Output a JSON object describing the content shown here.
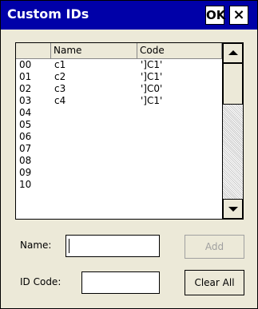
{
  "window": {
    "title": "Custom IDs",
    "ok_label": "OK",
    "close_label": "×"
  },
  "list": {
    "columns": [
      "",
      "Name",
      "Code"
    ],
    "rows": [
      {
        "idx": "00",
        "name": "c1",
        "code": "']C1'"
      },
      {
        "idx": "01",
        "name": "c2",
        "code": "']C1'"
      },
      {
        "idx": "02",
        "name": "c3",
        "code": "']C0'"
      },
      {
        "idx": "03",
        "name": "c4",
        "code": "']C1'"
      },
      {
        "idx": "04",
        "name": "",
        "code": ""
      },
      {
        "idx": "05",
        "name": "",
        "code": ""
      },
      {
        "idx": "06",
        "name": "",
        "code": ""
      },
      {
        "idx": "07",
        "name": "",
        "code": ""
      },
      {
        "idx": "08",
        "name": "",
        "code": ""
      },
      {
        "idx": "09",
        "name": "",
        "code": ""
      },
      {
        "idx": "10",
        "name": "",
        "code": ""
      }
    ]
  },
  "form": {
    "name_label": "Name:",
    "name_value": "",
    "id_code_label": "ID Code:",
    "id_code_value": "",
    "add_label": "Add",
    "clear_all_label": "Clear All"
  },
  "colors": {
    "titlebar": "#0000a8",
    "dialog_bg": "#ece9d8",
    "disabled_text": "#a0a0a0"
  },
  "icons": {
    "scroll_up": "triangle-up-icon",
    "scroll_down": "triangle-down-icon"
  }
}
